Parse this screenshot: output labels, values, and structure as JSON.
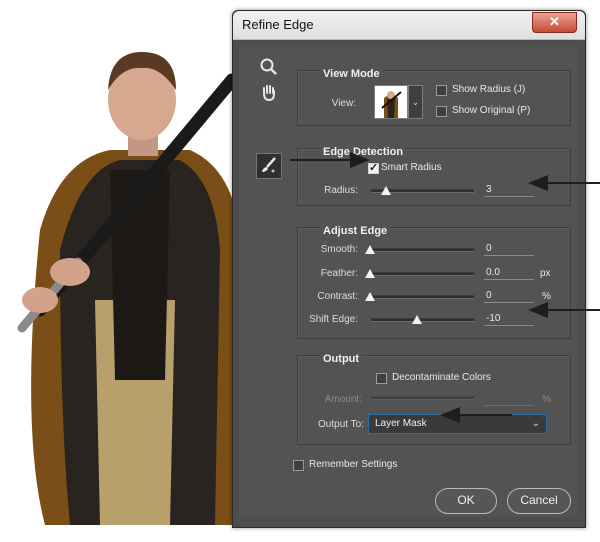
{
  "dialog": {
    "title": "Refine Edge",
    "close": "✕"
  },
  "tools": {
    "zoom": "zoom-tool",
    "hand": "hand-tool",
    "refine_brush": "refine-radius-brush"
  },
  "view_mode": {
    "title": "View Mode",
    "view_label": "View:",
    "show_radius": "Show Radius (J)",
    "show_radius_checked": false,
    "show_original": "Show Original (P)",
    "show_original_checked": false
  },
  "edge_detection": {
    "title": "Edge Detection",
    "smart_radius": "Smart Radius",
    "smart_radius_checked": true,
    "radius_label": "Radius:",
    "radius_value": "3",
    "radius_unit": ""
  },
  "adjust_edge": {
    "title": "Adjust Edge",
    "smooth_label": "Smooth:",
    "smooth_value": "0",
    "feather_label": "Feather:",
    "feather_value": "0.0",
    "feather_unit": "px",
    "contrast_label": "Contrast:",
    "contrast_value": "0",
    "contrast_unit": "%",
    "shift_edge_label": "Shift Edge:",
    "shift_edge_value": "-10"
  },
  "output": {
    "title": "Output",
    "decontaminate": "Decontaminate Colors",
    "decontaminate_checked": false,
    "amount_label": "Amount:",
    "amount_unit": "%",
    "output_to_label": "Output To:",
    "output_to_value": "Layer Mask"
  },
  "remember_settings": "Remember Settings",
  "remember_settings_checked": false,
  "buttons": {
    "ok": "OK",
    "cancel": "Cancel"
  },
  "colors": {
    "panel": "#535353",
    "accent_select_border": "#2f6ea5"
  }
}
